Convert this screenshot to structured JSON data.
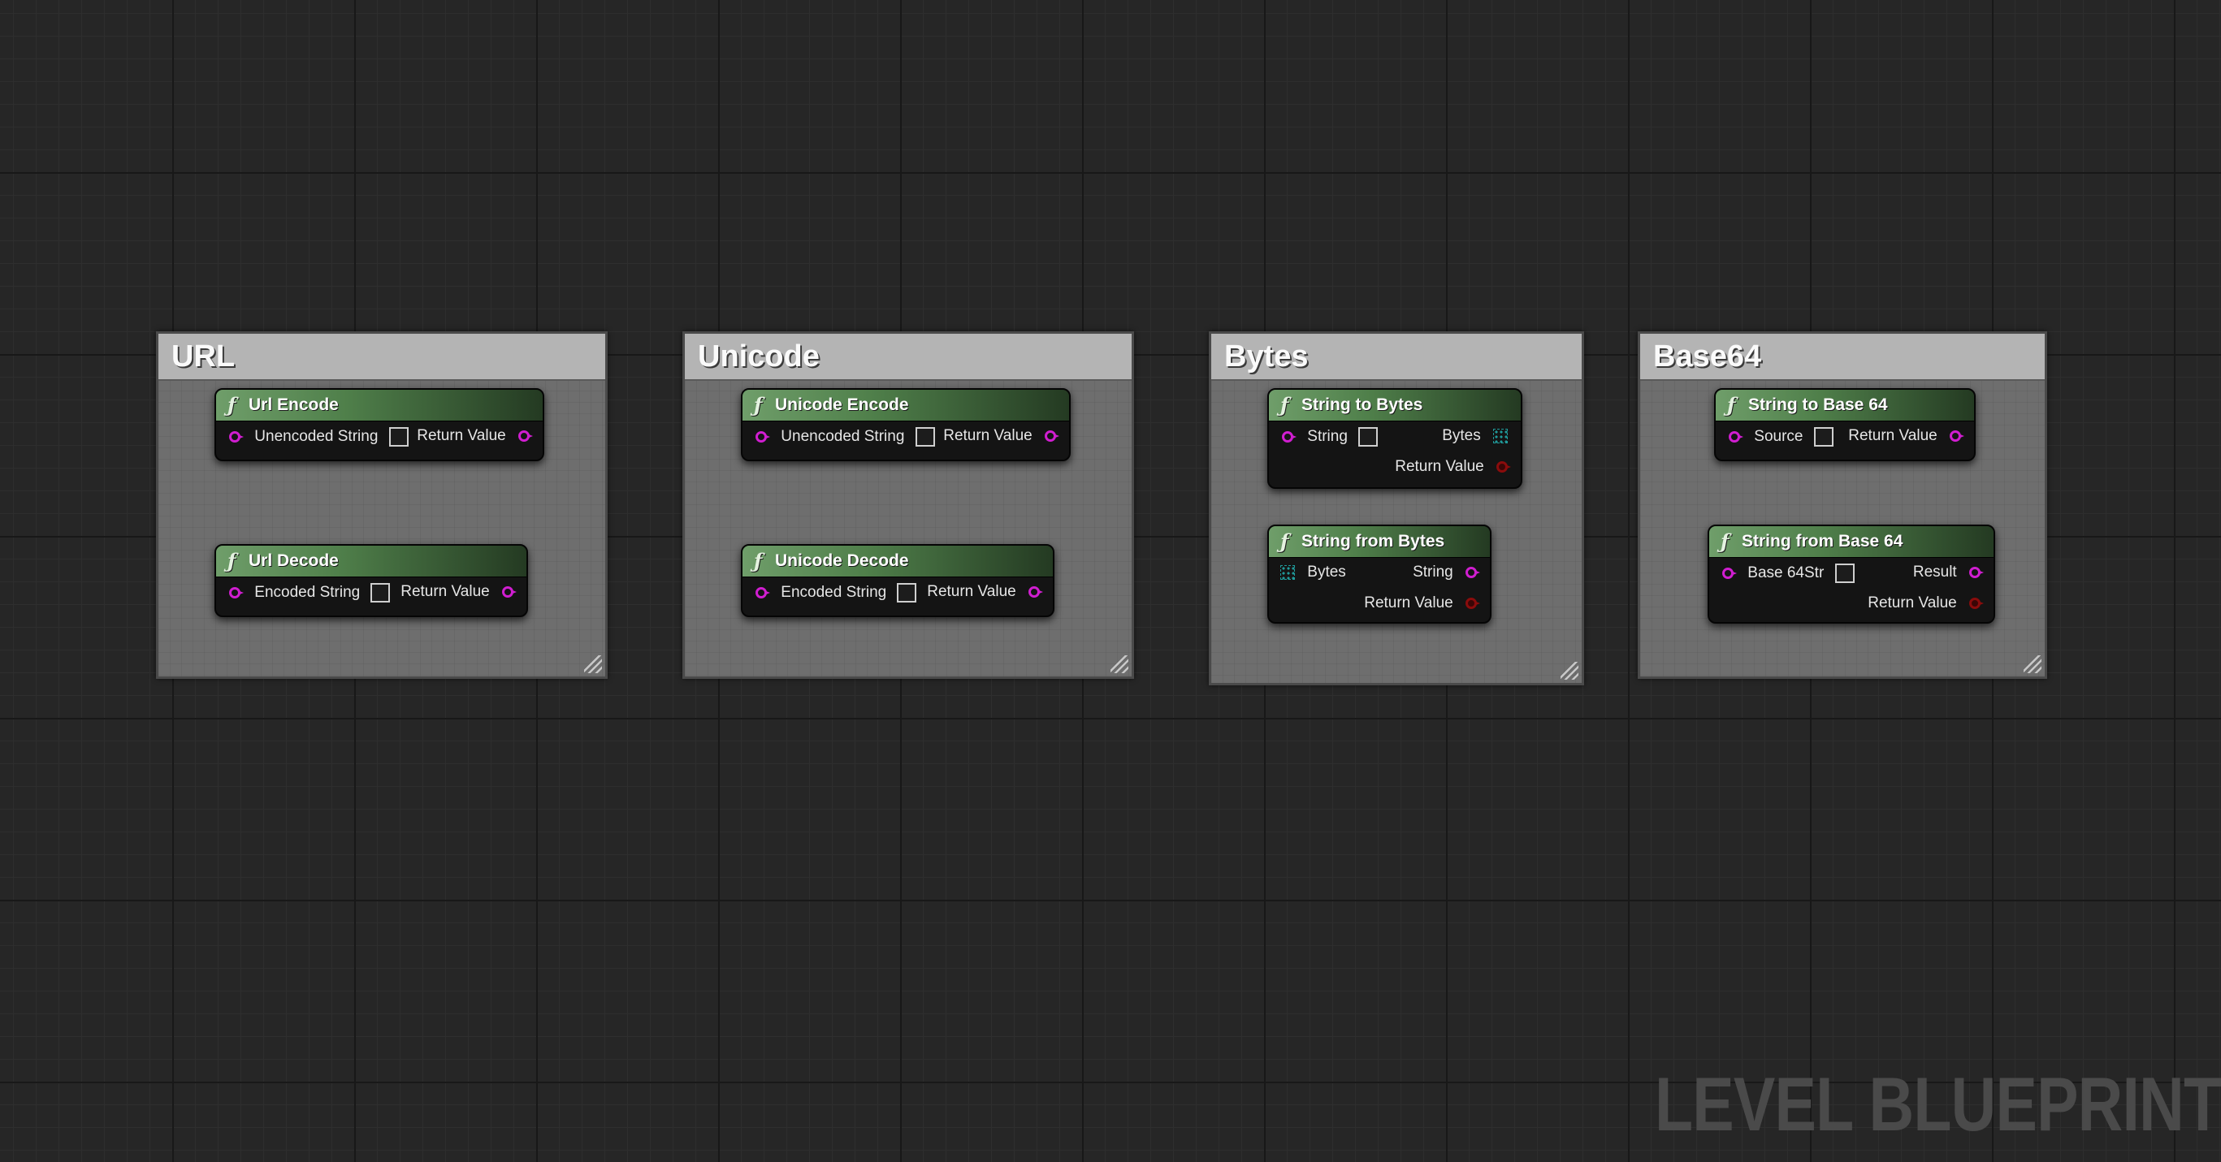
{
  "comments": [
    {
      "title": "URL"
    },
    {
      "title": "Unicode"
    },
    {
      "title": "Bytes"
    },
    {
      "title": "Base64"
    }
  ],
  "nodes": {
    "url_encode": {
      "title": "Url Encode",
      "input": "Unencoded String",
      "output": "Return Value"
    },
    "url_decode": {
      "title": "Url Decode",
      "input": "Encoded String",
      "output": "Return Value"
    },
    "unicode_encode": {
      "title": "Unicode Encode",
      "input": "Unencoded String",
      "output": "Return Value"
    },
    "unicode_decode": {
      "title": "Unicode Decode",
      "input": "Encoded String",
      "output": "Return Value"
    },
    "string_to_bytes": {
      "title": "String to Bytes",
      "input": "String",
      "output1": "Bytes",
      "output2": "Return Value"
    },
    "string_from_bytes": {
      "title": "String from Bytes",
      "input": "Bytes",
      "output1": "String",
      "output2": "Return Value"
    },
    "string_to_base64": {
      "title": "String to Base 64",
      "input": "Source",
      "output": "Return Value"
    },
    "string_from_base64": {
      "title": "String from Base 64",
      "input": "Base 64Str",
      "output1": "Result",
      "output2": "Return Value"
    }
  },
  "function_glyph": "ƒ",
  "watermark": "LEVEL BLUEPRINT",
  "colors": {
    "string_pin": "#d01ed0",
    "bool_pin": "#8a0c0c",
    "byte_array_pin": "#1f9a9a",
    "node_header": "#4f7f4a",
    "comment_bg": "#6e6e6e",
    "graph_bg": "#262626"
  }
}
